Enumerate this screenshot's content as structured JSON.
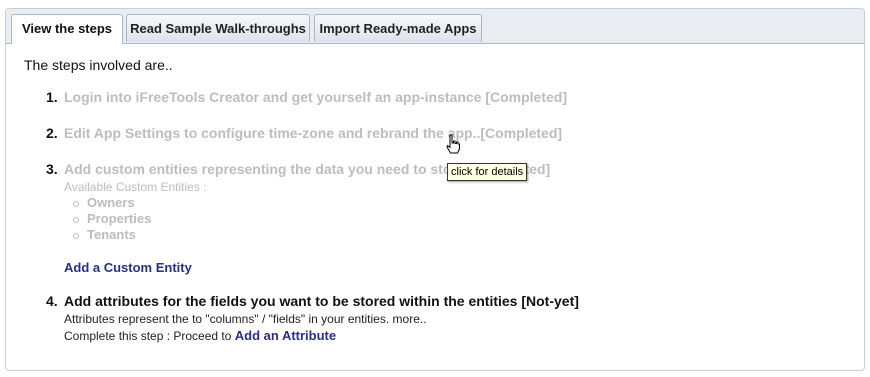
{
  "tabs": [
    {
      "label": "View the steps",
      "active": true
    },
    {
      "label": "Read Sample Walk-throughs",
      "active": false
    },
    {
      "label": "Import Ready-made Apps",
      "active": false
    }
  ],
  "intro": "The steps involved are..",
  "steps": [
    {
      "number": "1.",
      "text": "Login into iFreeTools Creator and get yourself an app-instance [Completed]"
    },
    {
      "number": "2.",
      "text": "Edit App Settings to configure time-zone and rebrand the app..[Completed]"
    },
    {
      "number": "3.",
      "text": "Add custom entities representing the data you need to store [Completed]",
      "sub_label": "Available Custom Entities :",
      "entities": [
        "Owners",
        "Properties",
        "Tenants"
      ],
      "link": "Add a Custom Entity"
    },
    {
      "number": "4.",
      "text": "Add attributes for the fields you want to be stored within the entities [Not-yet]",
      "description": "Attributes represent the to \"columns\" / \"fields\" in your entities. more..",
      "proceed_prefix": "Complete this step : Proceed to",
      "link": "Add an Attribute"
    }
  ],
  "tooltip": "click for details",
  "colors": {
    "completed": "#bdbdbd",
    "link": "#2a2e84",
    "tooltip_bg": "#ffffe1"
  },
  "cursor_icon": "hand-pointer-icon"
}
